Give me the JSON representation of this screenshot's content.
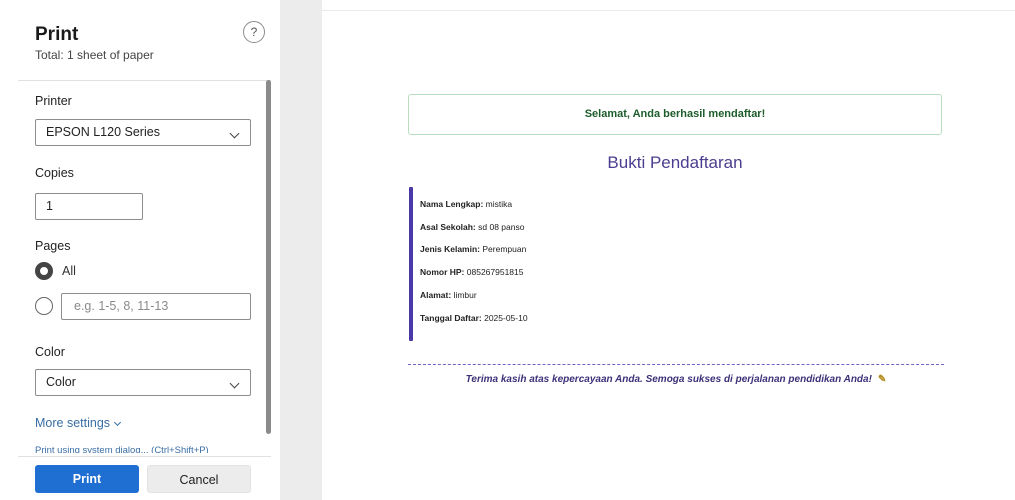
{
  "print_panel": {
    "title": "Print",
    "subtitle": "Total: 1 sheet of paper",
    "help_glyph": "?",
    "printer": {
      "label": "Printer",
      "value": "EPSON L120 Series"
    },
    "copies": {
      "label": "Copies",
      "value": "1"
    },
    "pages": {
      "label": "Pages",
      "all_label": "All",
      "range_placeholder": "e.g. 1-5, 8, 11-13",
      "selected": "All"
    },
    "color": {
      "label": "Color",
      "value": "Color"
    },
    "more_settings": "More settings",
    "custom_dialog": "Print using system dialog... (Ctrl+Shift+P)",
    "print_button": "Print",
    "cancel_button": "Cancel"
  },
  "preview": {
    "alert": "Selamat, Anda berhasil mendaftar!",
    "title": "Bukti Pendaftaran",
    "fields": [
      {
        "label": "Nama Lengkap:",
        "value": "mistika"
      },
      {
        "label": "Asal Sekolah:",
        "value": "sd 08 panso"
      },
      {
        "label": "Jenis Kelamin:",
        "value": "Perempuan"
      },
      {
        "label": "Nomor HP:",
        "value": "085267951815"
      },
      {
        "label": "Alamat:",
        "value": "limbur"
      },
      {
        "label": "Tanggal Daftar:",
        "value": "2025-05-10"
      }
    ],
    "thanks": "Terima kasih atas kepercayaan Anda. Semoga sukses di perjalanan pendidikan Anda!",
    "thanks_icon": "pen-icon"
  },
  "colors": {
    "accent": "#1e6fd1",
    "alert_text": "#1d5c2b",
    "title_purple": "#4b3d8f"
  }
}
